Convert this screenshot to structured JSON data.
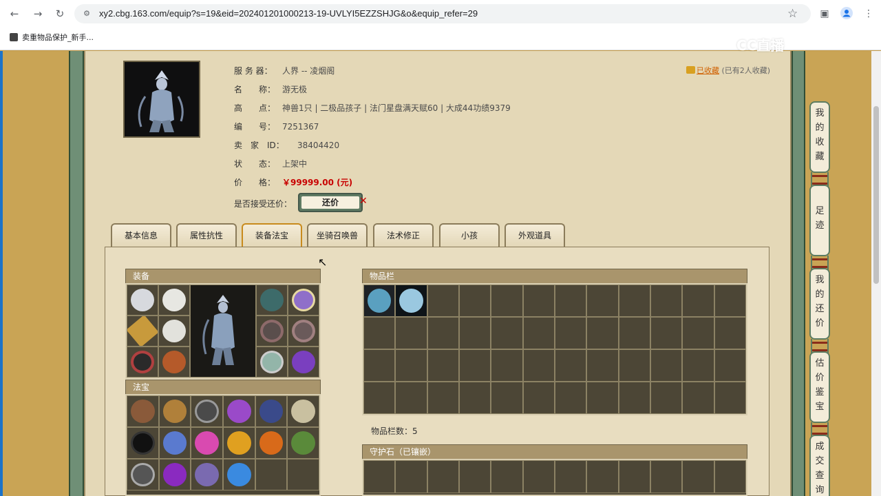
{
  "browser": {
    "url": "xy2.cbg.163.com/equip?s=19&eid=202401201000213-19-UVLYI5EZZSHJG&o&equip_refer=29",
    "bookmark": "卖重物品保护_新手..."
  },
  "watermark": "CC直播",
  "info": {
    "server_label": "服 务 器：",
    "server_value": "人界 -- 凌烟阁",
    "name_label": "名　　称：",
    "name_value": "游无极",
    "highlight_label": "高　　点：",
    "highlight_value": "神兽1只 | 二极品孩子 | 法门星盘满天赋60 | 大成44功绩9379",
    "id_label": "编　　号：",
    "id_value": "7251367",
    "seller_label": "卖　家　ID：",
    "seller_value": "38404420",
    "status_label": "状　　态：",
    "status_value": "上架中",
    "price_label": "价　　格：",
    "price_value": "￥99999.00 (元)",
    "haggle_label": "是否接受还价：",
    "haggle_button": "还价"
  },
  "favorite": {
    "link": "已收藏",
    "count": "(已有2人收藏)"
  },
  "tabs": [
    "基本信息",
    "属性抗性",
    "装备法宝",
    "坐骑召唤兽",
    "法术修正",
    "小孩",
    "外观道具"
  ],
  "active_tab": 2,
  "sections": {
    "equipment": "装备",
    "treasure": "法宝",
    "inventory": "物品栏",
    "inventory_count": "物品栏数：5",
    "guardstone": "守护石（已镶嵌）"
  },
  "sidebar": [
    "我的收藏",
    "足迹",
    "我的还价",
    "估价鉴宝",
    "成交查询"
  ],
  "colors": {
    "page_bg": "#c59c4a",
    "panel_bg": "#e4d8b7",
    "cell": "#4c4636",
    "accent_green": "#5c7c62",
    "price": "#c80000",
    "section_header": "#a9956c"
  }
}
